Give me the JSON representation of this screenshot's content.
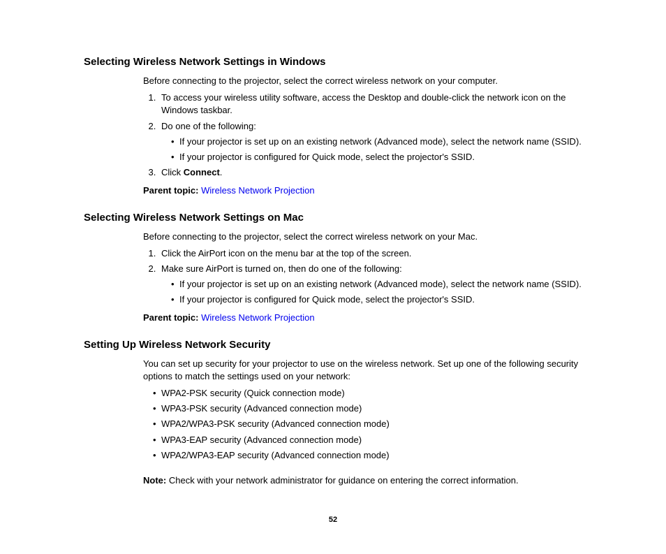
{
  "section1": {
    "heading": "Selecting Wireless Network Settings in Windows",
    "intro": "Before connecting to the projector, select the correct wireless network on your computer.",
    "step1": "To access your wireless utility software, access the Desktop and double-click the network icon on the Windows taskbar.",
    "step2": "Do one of the following:",
    "bullet1": "If your projector is set up on an existing network (Advanced mode), select the network name (SSID).",
    "bullet2": "If your projector is configured for Quick mode, select the projector's SSID.",
    "step3_pre": "Click ",
    "step3_bold": "Connect",
    "step3_post": ".",
    "parent_label": "Parent topic: ",
    "parent_link": "Wireless Network Projection"
  },
  "section2": {
    "heading": "Selecting Wireless Network Settings on Mac",
    "intro": "Before connecting to the projector, select the correct wireless network on your Mac.",
    "step1": "Click the AirPort icon on the menu bar at the top of the screen.",
    "step2": "Make sure AirPort is turned on, then do one of the following:",
    "bullet1": "If your projector is set up on an existing network (Advanced mode), select the network name (SSID).",
    "bullet2": "If your projector is configured for Quick mode, select the projector's SSID.",
    "parent_label": "Parent topic: ",
    "parent_link": "Wireless Network Projection"
  },
  "section3": {
    "heading": "Setting Up Wireless Network Security",
    "intro": "You can set up security for your projector to use on the wireless network. Set up one of the following security options to match the settings used on your network:",
    "bullet1": "WPA2-PSK security (Quick connection mode)",
    "bullet2": "WPA3-PSK security (Advanced connection mode)",
    "bullet3": "WPA2/WPA3-PSK security (Advanced connection mode)",
    "bullet4": "WPA3-EAP security (Advanced connection mode)",
    "bullet5": "WPA2/WPA3-EAP security (Advanced connection mode)",
    "note_label": "Note: ",
    "note_text": "Check with your network administrator for guidance on entering the correct information."
  },
  "page_number": "52"
}
